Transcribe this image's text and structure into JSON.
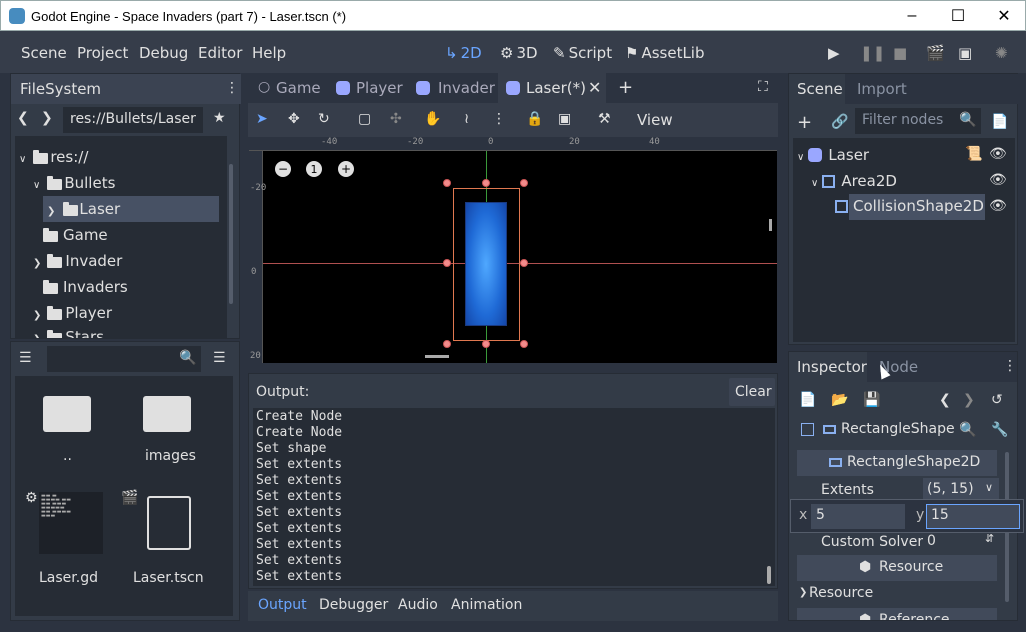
{
  "window": {
    "title": "Godot Engine - Space Invaders (part 7) - Laser.tscn (*)"
  },
  "menu": [
    "Scene",
    "Project",
    "Debug",
    "Editor",
    "Help"
  ],
  "workspaces": [
    "2D",
    "3D",
    "Script",
    "AssetLib"
  ],
  "filesystem": {
    "tab": "FileSystem",
    "path": "res://Bullets/Laser",
    "tree": [
      "res://",
      "Bullets",
      "Laser",
      "Game",
      "Invader",
      "Invaders",
      "Player",
      "Stars"
    ],
    "files": [
      "..",
      "images",
      "Laser.gd",
      "Laser.tscn"
    ]
  },
  "scene_tabs": [
    "Game",
    "Player",
    "Invader",
    "Laser(*)"
  ],
  "toolbar": {
    "view": "View"
  },
  "ruler": {
    "top": [
      "-40",
      "-20",
      "0",
      "20",
      "40"
    ],
    "left": [
      "-20",
      "0",
      "20"
    ]
  },
  "zoom": {
    "reset": "1"
  },
  "output": {
    "label": "Output:",
    "clear": "Clear",
    "lines": [
      "Create Node",
      "Create Node",
      "Set shape",
      "Set extents",
      "Set extents",
      "Set extents",
      "Set extents",
      "Set extents",
      "Set extents",
      "Set extents",
      "Set extents"
    ],
    "tabs": [
      "Output",
      "Debugger",
      "Audio",
      "Animation"
    ]
  },
  "scene_dock": {
    "tabs": [
      "Scene",
      "Import"
    ],
    "filter_placeholder": "Filter nodes",
    "nodes": [
      "Laser",
      "Area2D",
      "CollisionShape2D"
    ]
  },
  "inspector": {
    "tabs": [
      "Inspector",
      "Node"
    ],
    "object": "RectangleShape",
    "section": "RectangleShape2D",
    "extents_label": "Extents",
    "extents_value": "(5, 15)",
    "x_label": "x",
    "x_value": "5",
    "y_label": "y",
    "y_value": "15",
    "custom_solver_label": "Custom Solver",
    "custom_solver_value": "0",
    "resource_button": "Resource",
    "resource_group": "Resource",
    "reference_button": "Reference"
  },
  "colors": {
    "accent": "#6aa5ff",
    "bg": "#2c3340",
    "panel": "#333b47",
    "selection": "#475164"
  }
}
